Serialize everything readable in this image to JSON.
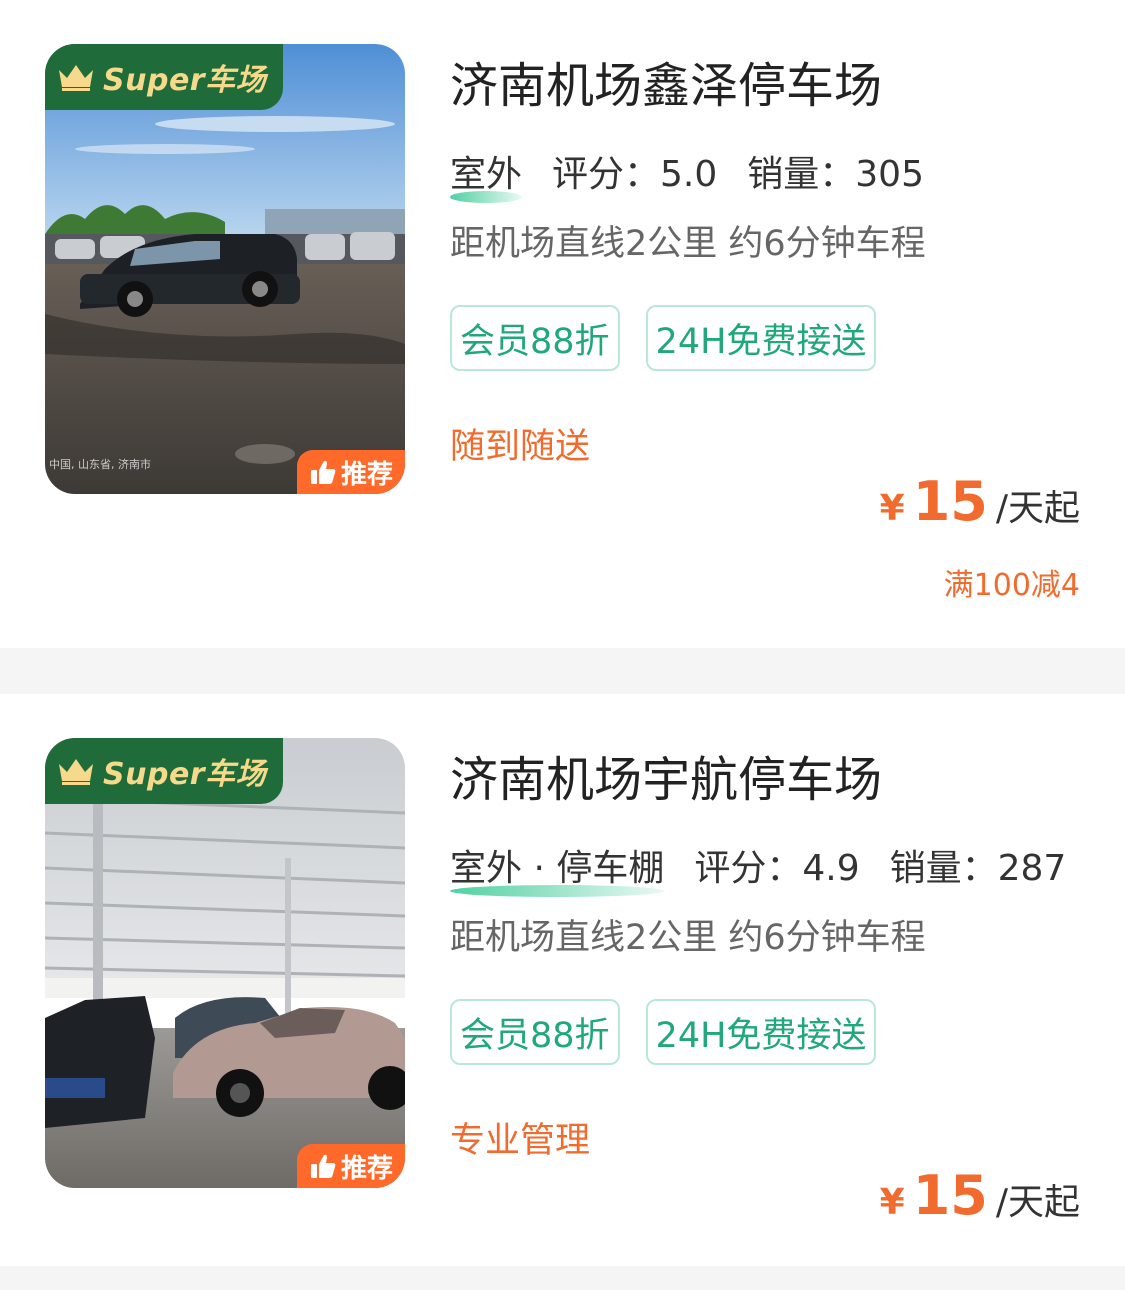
{
  "listings": [
    {
      "super_badge": "Super车场",
      "recommend_badge": "推荐",
      "photo_watermark": "中国, 山东省, 济南市",
      "name": "济南机场鑫泽停车场",
      "location_type": "室外",
      "rating": "评分：5.0",
      "sales": "销量：305",
      "distance": "距机场直线2公里 约6分钟车程",
      "tags": [
        "会员88折",
        "24H免费接送"
      ],
      "slogan": "随到随送",
      "price": {
        "currency": "¥",
        "amount": "15",
        "unit": "/天起"
      },
      "discount": "满100减4"
    },
    {
      "super_badge": "Super车场",
      "recommend_badge": "推荐",
      "name": "济南机场宇航停车场",
      "location_type": "室外 · 停车棚",
      "rating": "评分：4.9",
      "sales": "销量：287",
      "distance": "距机场直线2公里 约6分钟车程",
      "tags": [
        "会员88折",
        "24H免费接送"
      ],
      "slogan": "专业管理",
      "price": {
        "currency": "¥",
        "amount": "15",
        "unit": "/天起"
      }
    }
  ],
  "colors": {
    "accent_orange": "#f26b2e",
    "tag_green": "#20a77a",
    "badge_green": "#1f6b3a",
    "badge_gold": "#f6d98a"
  },
  "icons": [
    "crown-icon",
    "thumbs-up-icon"
  ]
}
